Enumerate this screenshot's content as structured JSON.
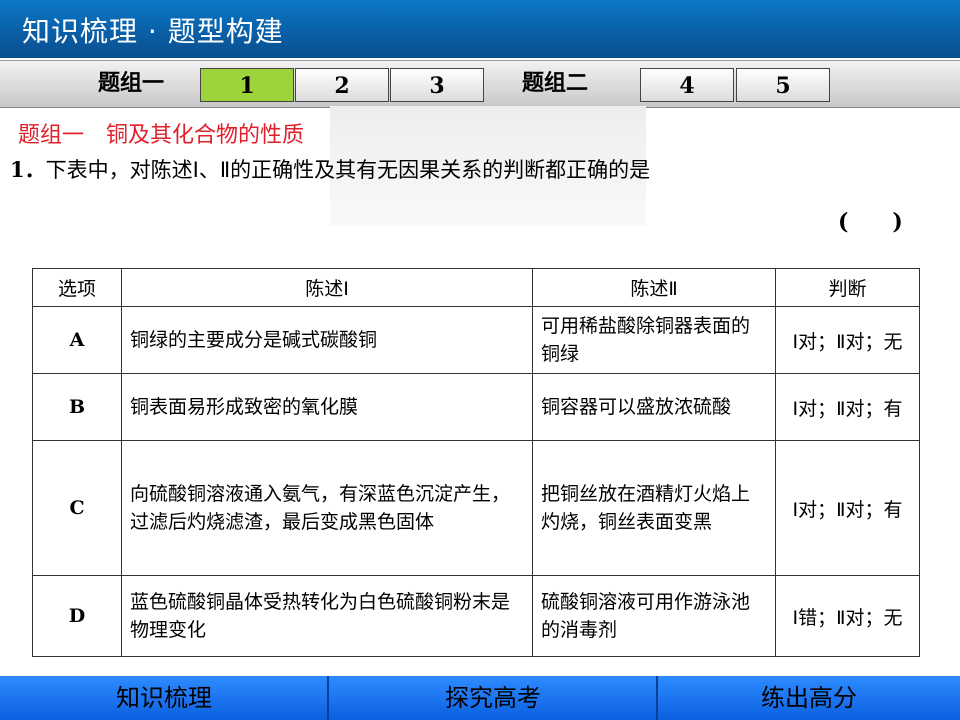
{
  "header": {
    "title": "知识梳理 · 题型构建"
  },
  "nav": {
    "group1_label": "题组一",
    "group2_label": "题组二",
    "tabs": [
      "1",
      "2",
      "3",
      "4",
      "5"
    ],
    "active_tab": "1"
  },
  "section": {
    "group": "题组一",
    "topic": "铜及其化合物的性质"
  },
  "question": {
    "number": "1．",
    "text": "下表中，对陈述Ⅰ、Ⅱ的正确性及其有无因果关系的判断都正确的是",
    "answer_blank": "(　　)"
  },
  "table": {
    "headers": [
      "选项",
      "陈述Ⅰ",
      "陈述Ⅱ",
      "判断"
    ],
    "rows": [
      {
        "option": "A",
        "s1": "铜绿的主要成分是碱式碳酸铜",
        "s2": "可用稀盐酸除铜器表面的铜绿",
        "judge": "Ⅰ对；Ⅱ对；无"
      },
      {
        "option": "B",
        "s1": "铜表面易形成致密的氧化膜",
        "s2": "铜容器可以盛放浓硫酸",
        "judge": "Ⅰ对；Ⅱ对；有"
      },
      {
        "option": "C",
        "s1": "向硫酸铜溶液通入氨气，有深蓝色沉淀产生，过滤后灼烧滤渣，最后变成黑色固体",
        "s2": "把铜丝放在酒精灯火焰上灼烧，铜丝表面变黑",
        "judge": "Ⅰ对；Ⅱ对；有"
      },
      {
        "option": "D",
        "s1": "蓝色硫酸铜晶体受热转化为白色硫酸铜粉末是物理变化",
        "s2": "硫酸铜溶液可用作游泳池的消毒剂",
        "judge": "Ⅰ错；Ⅱ对；无"
      }
    ]
  },
  "footer": {
    "buttons": [
      "知识梳理",
      "探究高考",
      "练出高分"
    ]
  },
  "colors": {
    "header_blue": "#0a5fa8",
    "active_tab": "#9ed33c",
    "heading_red": "#e0202a",
    "footer_blue": "#1a73f0"
  }
}
